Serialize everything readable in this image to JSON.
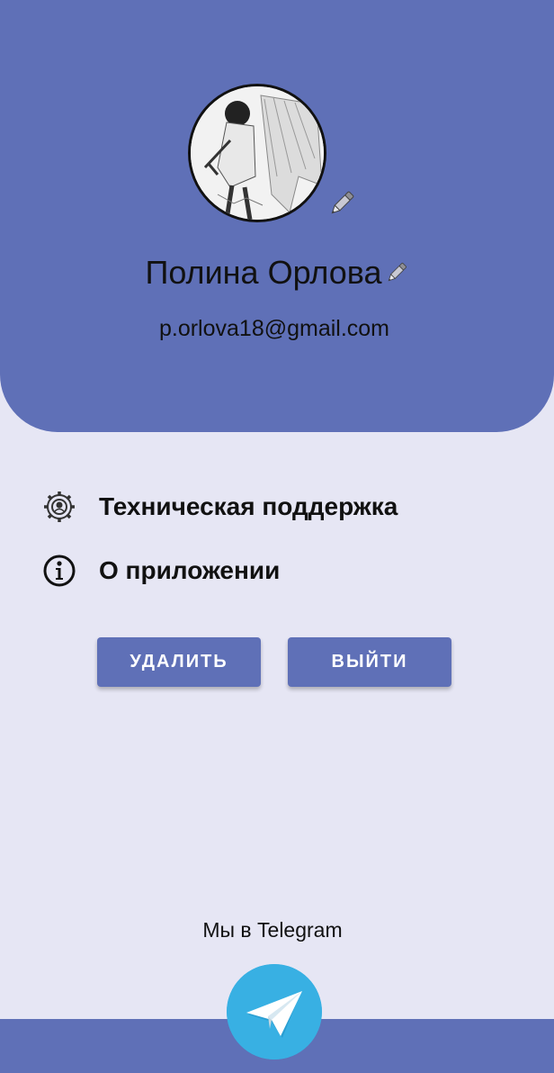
{
  "profile": {
    "name": "Полина Орлова",
    "email": "p.orlova18@gmail.com"
  },
  "menu": {
    "support": {
      "label": "Техническая поддержка",
      "icon": "gear-icon"
    },
    "about": {
      "label": "О приложении",
      "icon": "info-icon"
    }
  },
  "actions": {
    "delete_label": "УДАЛИТЬ",
    "logout_label": "ВЫЙТИ"
  },
  "footer": {
    "telegram_label": "Мы в Telegram",
    "telegram_icon": "telegram-icon"
  },
  "colors": {
    "primary": "#5f70b7",
    "background": "#e6e6f4",
    "telegram": "#38b0e3"
  }
}
